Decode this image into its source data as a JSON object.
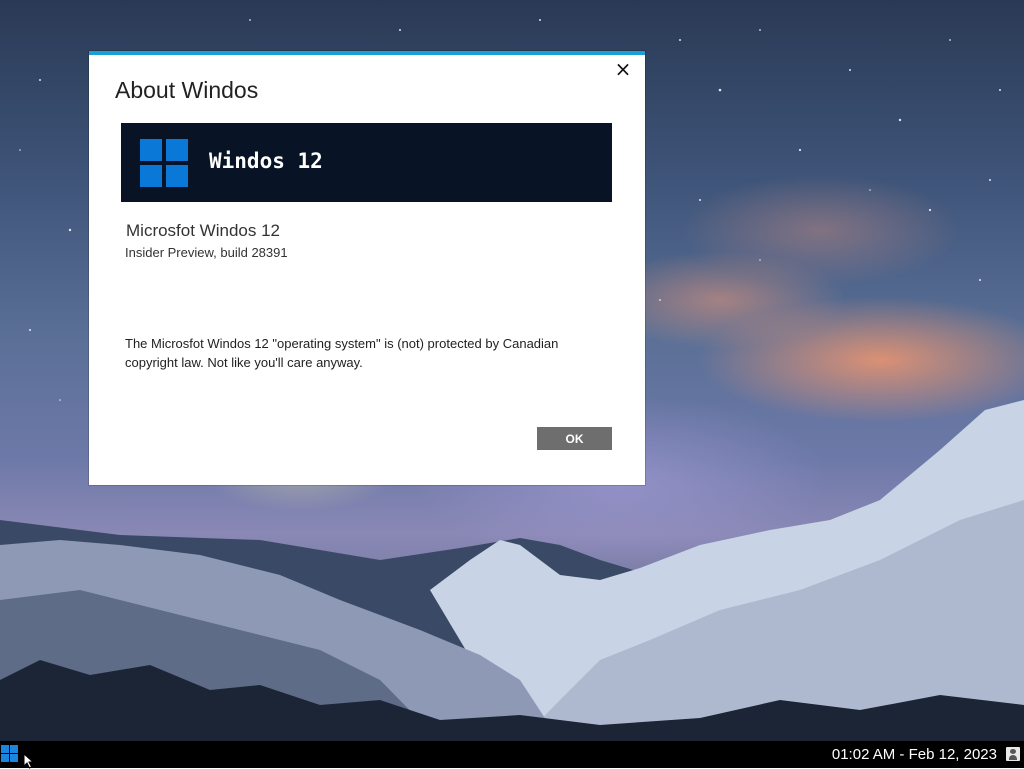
{
  "dialog": {
    "title": "About Windos",
    "close_icon": "×",
    "banner_title": "Windos 12",
    "product_name": "Microsfot Windos 12",
    "build_info": "Insider Preview, build 28391",
    "legal_notice": "The Microsfot Windos 12 \"operating system\" is (not) protected by Canadian copyright law. Not like you'll care anyway.",
    "ok_label": "OK",
    "accent_color": "#1aa0d8",
    "banner_color": "#081425",
    "logo_color": "#0a78d7"
  },
  "taskbar": {
    "start_icon": "windows-logo-icon",
    "clock": "01:02 AM - Feb 12, 2023",
    "tray_icon": "user-icon"
  }
}
